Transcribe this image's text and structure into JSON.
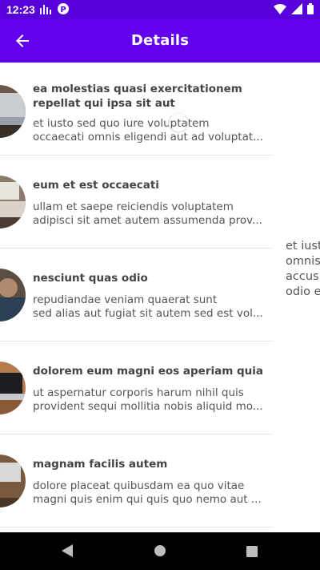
{
  "status_bar": {
    "time": "12:23",
    "icons_left": [
      "signal-bars-icon",
      "app-notification-icon"
    ],
    "icons_right": [
      "wifi-icon",
      "cellular-icon",
      "battery-icon"
    ]
  },
  "app_bar": {
    "title": "Details",
    "back_icon": "arrow-left-icon",
    "background": "#6200ee",
    "status_background": "#5800d9"
  },
  "list": {
    "items": [
      {
        "title_1": "ea molestias quasi exercitationem",
        "title_2": "repellat qui ipsa sit aut",
        "body_1": "et iusto sed quo iure voluptatem",
        "body_2": "occaecati omnis eligendi aut ad voluptat...",
        "thumb": "laptop-photo"
      },
      {
        "title_1": "eum et est occaecati",
        "title_2": "",
        "body_1": "ullam et saepe reiciendis voluptatem",
        "body_2": "adipisci sit amet autem assumenda prov...",
        "thumb": "desk-photo"
      },
      {
        "title_1": "nesciunt quas odio",
        "title_2": "",
        "body_1": "repudiandae veniam quaerat sunt",
        "body_2": "sed alias aut fugiat sit autem sed est vol...",
        "thumb": "person-laptop-photo"
      },
      {
        "title_1": "dolorem eum magni eos aperiam quia",
        "title_2": "",
        "body_1": "ut aspernatur corporis harum nihil quis",
        "body_2": "provident sequi mollitia nobis aliquid mo...",
        "thumb": "laptop-table-photo"
      },
      {
        "title_1": "magnam facilis autem",
        "title_2": "",
        "body_1": "dolore placeat quibusdam ea quo vitae",
        "body_2": "magni quis enim qui quis quo nemo aut ...",
        "thumb": "workspace-photo"
      }
    ]
  },
  "side_panel": {
    "lines": [
      "et iust",
      "omnis",
      "accus",
      "odio e"
    ]
  },
  "nav_bar": {
    "icons": [
      "back-triangle-icon",
      "home-circle-icon",
      "recents-square-icon"
    ]
  }
}
